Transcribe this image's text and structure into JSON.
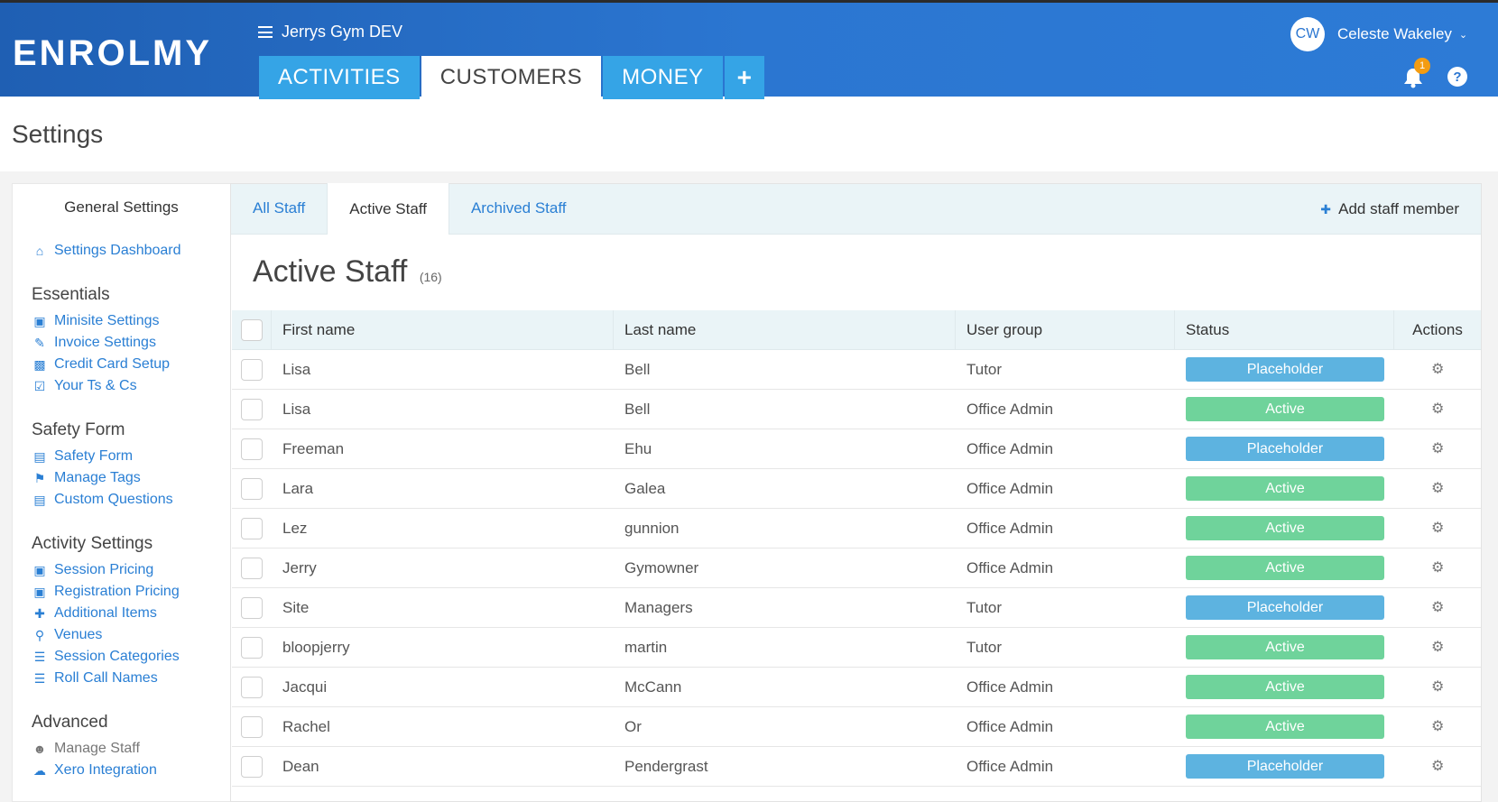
{
  "header": {
    "logo_text": "ENROLMY",
    "app_name": "Jerrys Gym DEV",
    "tabs": [
      {
        "label": "ACTIVITIES"
      },
      {
        "label": "CUSTOMERS"
      },
      {
        "label": "MONEY"
      },
      {
        "label": "+"
      }
    ],
    "user_initials": "CW",
    "user_name": "Celeste Wakeley",
    "notification_count": "1",
    "help_icon": "?"
  },
  "page_title": "Settings",
  "sidebar": {
    "header": "General Settings",
    "dashboard": {
      "label": "Settings Dashboard",
      "icon": "home-icon"
    },
    "sections": [
      {
        "title": "Essentials",
        "items": [
          {
            "label": "Minisite Settings",
            "icon": "cube-icon"
          },
          {
            "label": "Invoice Settings",
            "icon": "pencil-icon"
          },
          {
            "label": "Credit Card Setup",
            "icon": "money-icon"
          },
          {
            "label": "Your Ts & Cs",
            "icon": "check-square-icon"
          }
        ]
      },
      {
        "title": "Safety Form",
        "items": [
          {
            "label": "Safety Form",
            "icon": "file-icon"
          },
          {
            "label": "Manage Tags",
            "icon": "tags-icon"
          },
          {
            "label": "Custom Questions",
            "icon": "file-icon"
          }
        ]
      },
      {
        "title": "Activity Settings",
        "items": [
          {
            "label": "Session Pricing",
            "icon": "briefcase-icon"
          },
          {
            "label": "Registration Pricing",
            "icon": "briefcase-icon"
          },
          {
            "label": "Additional Items",
            "icon": "puzzle-icon"
          },
          {
            "label": "Venues",
            "icon": "map-marker-icon"
          },
          {
            "label": "Session Categories",
            "icon": "list-icon"
          },
          {
            "label": "Roll Call Names",
            "icon": "list-icon"
          }
        ]
      },
      {
        "title": "Advanced",
        "items": [
          {
            "label": "Manage Staff",
            "icon": "users-icon"
          },
          {
            "label": "Xero Integration",
            "icon": "cloud-icon"
          }
        ]
      }
    ]
  },
  "subtabs": [
    {
      "label": "All Staff"
    },
    {
      "label": "Active Staff"
    },
    {
      "label": "Archived Staff"
    }
  ],
  "add_staff_label": "Add staff member",
  "panel": {
    "title": "Active Staff",
    "count": "(16)"
  },
  "table": {
    "columns": [
      "First name",
      "Last name",
      "User group",
      "Status",
      "Actions"
    ],
    "rows": [
      {
        "first": "Lisa",
        "last": "Bell",
        "group": "Tutor",
        "status": "Placeholder"
      },
      {
        "first": "Lisa",
        "last": "Bell",
        "group": "Office Admin",
        "status": "Active"
      },
      {
        "first": "Freeman",
        "last": "Ehu",
        "group": "Office Admin",
        "status": "Placeholder"
      },
      {
        "first": "Lara",
        "last": "Galea",
        "group": "Office Admin",
        "status": "Active"
      },
      {
        "first": "Lez",
        "last": "gunnion",
        "group": "Office Admin",
        "status": "Active"
      },
      {
        "first": "Jerry",
        "last": "Gymowner",
        "group": "Office Admin",
        "status": "Active"
      },
      {
        "first": "Site",
        "last": "Managers",
        "group": "Tutor",
        "status": "Placeholder"
      },
      {
        "first": "bloopjerry",
        "last": "martin",
        "group": "Tutor",
        "status": "Active"
      },
      {
        "first": "Jacqui",
        "last": "McCann",
        "group": "Office Admin",
        "status": "Active"
      },
      {
        "first": "Rachel",
        "last": "Or",
        "group": "Office Admin",
        "status": "Active"
      },
      {
        "first": "Dean",
        "last": "Pendergrast",
        "group": "Office Admin",
        "status": "Placeholder"
      }
    ]
  },
  "colors": {
    "header_blue": "#2b76d1",
    "tab_blue": "#35a4e6",
    "link_blue": "#2a7fd4",
    "status_active": "#6fd39b",
    "status_placeholder": "#5db3e0",
    "badge_orange": "#f39c12"
  }
}
